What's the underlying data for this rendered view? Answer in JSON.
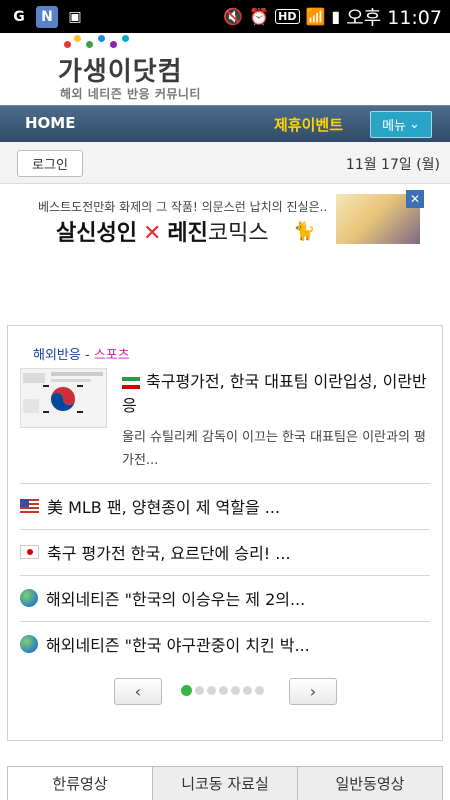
{
  "statusbar": {
    "time": "오후 11:07",
    "hd": "HD"
  },
  "logo": {
    "title": "가생이닷컴",
    "subtitle": "해외 네티즌 반응 커뮤니티",
    "dot_colors": [
      "#e53935",
      "#fbc02d",
      "#43a047",
      "#1e88e5",
      "#8e24aa",
      "#00acc1"
    ]
  },
  "nav": {
    "home": "HOME",
    "event": "제휴이벤트",
    "menu": "메뉴"
  },
  "login": {
    "button": "로그인",
    "date": "11월 17일 (월)"
  },
  "ad": {
    "top_text": "베스트도전만화 화제의 그 작품! 의문스런 납치의 진실은..",
    "left": "살신성인",
    "x": "✕",
    "right_bold": "레진",
    "right_normal": "코믹스"
  },
  "news": {
    "category_main": "해외반응",
    "category_sep": " - ",
    "category_sub": "스포츠",
    "featured": {
      "title": "축구평가전, 한국 대표팀 이란입성, 이란반응",
      "desc": "울리 슈틸리케 감독이 이끄는 한국 대표팀은 이란과의 평가전..."
    },
    "items": [
      {
        "flag": "us",
        "text": "美 MLB 팬, 양현종이 제 역할을 ..."
      },
      {
        "flag": "jp",
        "text": "축구 평가전 한국, 요르단에 승리! ..."
      },
      {
        "flag": "globe",
        "text": "해외네티즌 \"한국의 이승우는 제 2의..."
      },
      {
        "flag": "globe",
        "text": "해외네티즌 \"한국 야구관중이 치킨 박..."
      }
    ],
    "pager": {
      "prev": "‹",
      "next": "›",
      "pages": 7,
      "active": 1
    }
  },
  "tabs": [
    "한류영상",
    "니코동 자료실",
    "일반동영상"
  ]
}
